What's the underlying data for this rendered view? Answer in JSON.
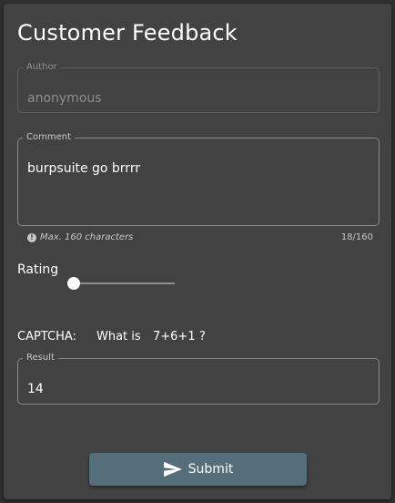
{
  "title": "Customer Feedback",
  "author": {
    "label": "Author",
    "value": "anonymous"
  },
  "comment": {
    "label": "Comment",
    "value": "burpsuite go brrrr",
    "hint": "Max. 160 characters",
    "counter": "18/160"
  },
  "rating": {
    "label": "Rating",
    "value": 0,
    "min": 0,
    "max": 5
  },
  "captcha": {
    "label": "CAPTCHA:",
    "question_prefix": "What is",
    "expression": "7+6+1",
    "question_suffix": "?"
  },
  "result": {
    "label": "Result",
    "value": "14"
  },
  "submit": {
    "label": "Submit",
    "icon": "send-icon"
  },
  "colors": {
    "card": "#424242",
    "background": "#303030",
    "button": "#546e7a"
  }
}
